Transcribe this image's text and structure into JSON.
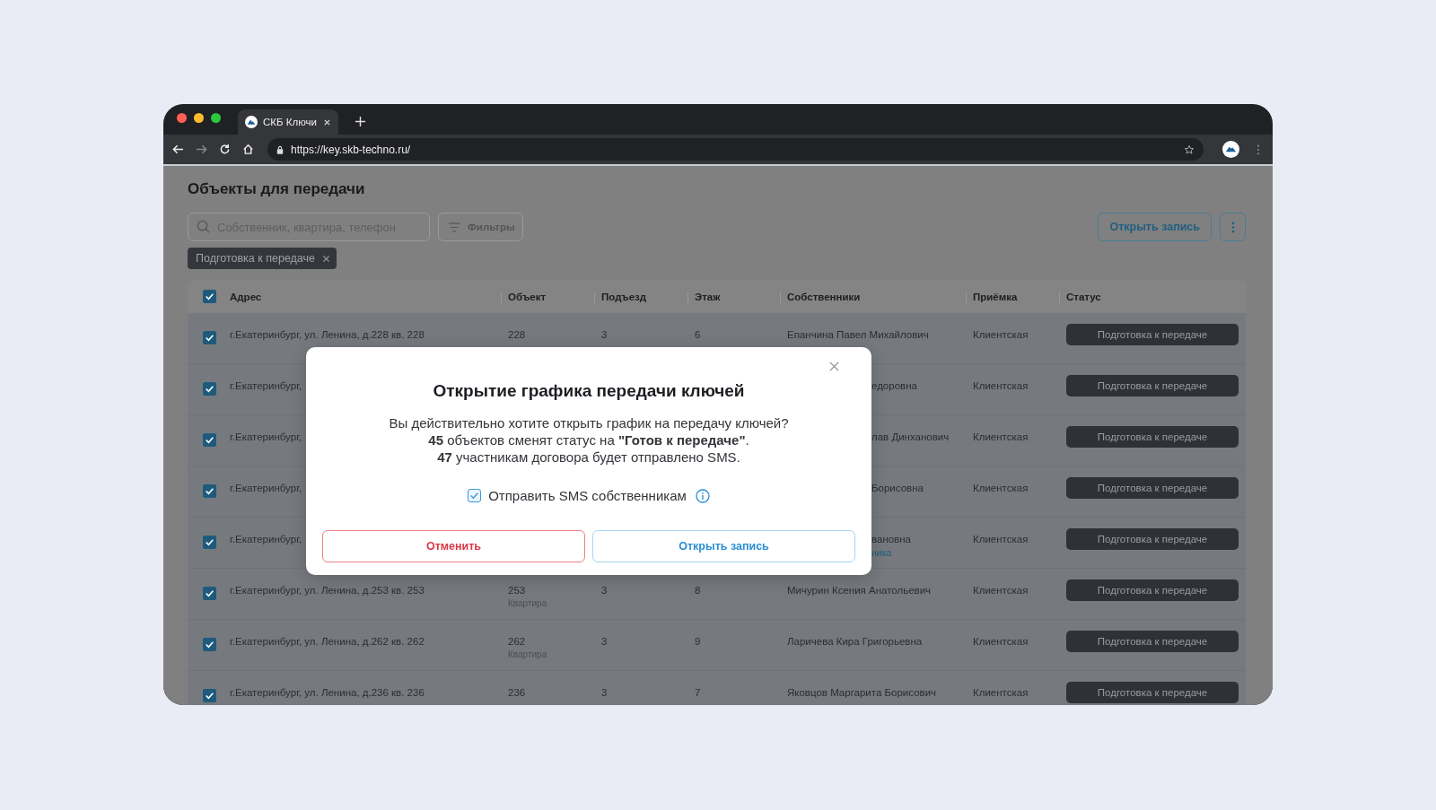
{
  "browser": {
    "tab_title": "СКБ Ключи",
    "url": "https://key.skb-techno.ru/"
  },
  "page": {
    "title": "Объекты для передачи",
    "search": {
      "placeholder": "Собственник, квартира, телефон"
    },
    "filters_button": "Фильтры",
    "open_button": "Открыть запись",
    "active_filters": [
      {
        "label": "Подготовка к передаче"
      }
    ]
  },
  "table": {
    "select_all_checked": true,
    "columns": [
      "Адрес",
      "Объект",
      "Подъезд",
      "Этаж",
      "Собственники",
      "Приёмка",
      "Статус"
    ],
    "rows": [
      {
        "checked": true,
        "covered": false,
        "address": "г.Екатеринбург, ул. Ленина, д.228 кв. 228",
        "object": "228",
        "entrance": "3",
        "floor": "6",
        "owners": "Епанчина Павел Михайлович",
        "acceptance": "Клиентская",
        "status": "Подготовка к передаче"
      },
      {
        "checked": true,
        "covered": true,
        "address": "г.Екатеринбург,",
        "owners": "едоровна",
        "acceptance": "Клиентская",
        "status": "Подготовка к передаче"
      },
      {
        "checked": true,
        "covered": true,
        "address": "г.Екатеринбург,",
        "owners": "лав Динханович",
        "acceptance": "Клиентская",
        "status": "Подготовка к передаче"
      },
      {
        "checked": true,
        "covered": true,
        "address": "г.Екатеринбург,",
        "owners": "Борисовна",
        "acceptance": "Клиентская",
        "status": "Подготовка к передаче"
      },
      {
        "checked": true,
        "covered": true,
        "address": "г.Екатеринбург,",
        "owners": "вановна",
        "owner_note": "ника",
        "acceptance": "Клиентская",
        "status": "Подготовка к передаче"
      },
      {
        "checked": true,
        "covered": false,
        "address": "г.Екатеринбург, ул. Ленина, д.253 кв. 253",
        "object": "253",
        "object_type": "Квартира",
        "entrance": "3",
        "floor": "8",
        "owners": "Мичурин Ксения Анатольевич",
        "acceptance": "Клиентская",
        "status": "Подготовка к передаче"
      },
      {
        "checked": true,
        "covered": false,
        "address": "г.Екатеринбург, ул. Ленина, д.262 кв. 262",
        "object": "262",
        "object_type": "Квартира",
        "entrance": "3",
        "floor": "9",
        "owners": "Ларичева Кира Григорьевна",
        "acceptance": "Клиентская",
        "status": "Подготовка к передаче"
      },
      {
        "checked": true,
        "covered": false,
        "address": "г.Екатеринбург, ул. Ленина, д.236 кв. 236",
        "object": "236",
        "entrance": "3",
        "floor": "7",
        "owners": "Яковцов Маргарита Борисович",
        "acceptance": "Клиентская",
        "status": "Подготовка к передаче"
      }
    ]
  },
  "dialog": {
    "title": "Открытие графика передачи ключей",
    "lines": [
      "Вы действительно хотите открыть график на передачу ключей?",
      "**45** объектов сменят статус на **\"Готов к передаче\"**.",
      "**47** участникам договора будет отправлено SMS."
    ],
    "sms_checkbox": {
      "label": "Отправить SMS собственникам",
      "checked": true
    },
    "cancel_button": "Отменить",
    "confirm_button": "Открыть запись"
  }
}
